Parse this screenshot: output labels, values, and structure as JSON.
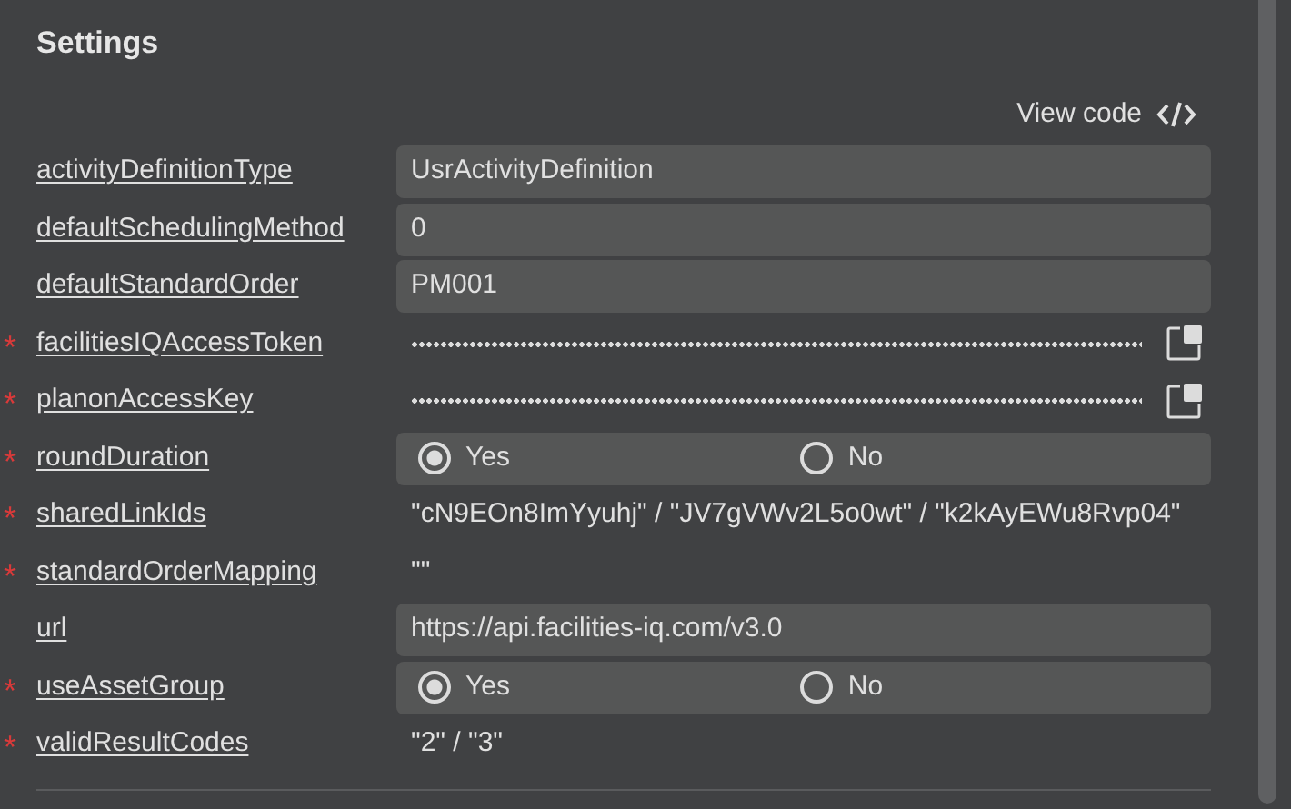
{
  "title": "Settings",
  "view_code": {
    "label": "View code"
  },
  "fields": [
    {
      "label": "activityDefinitionType",
      "kind": "text",
      "value": "UsrActivityDefinition"
    },
    {
      "label": "defaultSchedulingMethod",
      "kind": "text",
      "value": "0"
    },
    {
      "label": "defaultStandardOrder",
      "kind": "text",
      "value": "PM001"
    },
    {
      "label": "facilitiesIQAccessToken",
      "required_mark": "*",
      "kind": "secret"
    },
    {
      "label": "planonAccessKey",
      "required_mark": "*",
      "kind": "secret"
    },
    {
      "label": "roundDuration",
      "required_mark": "*",
      "kind": "radio",
      "options": [
        {
          "label": "Yes",
          "selected": true
        },
        {
          "label": "No",
          "selected": false
        }
      ]
    },
    {
      "label": "sharedLinkIds",
      "required_mark": "*",
      "kind": "plain",
      "value": "\"cN9EOn8ImYyuhj\" / \"JV7gVWv2L5o0wt\" / \"k2kAyEWu8Rvp04\""
    },
    {
      "label": "standardOrderMapping",
      "required_mark": "*",
      "kind": "plain",
      "value": "\"\""
    },
    {
      "label": "url",
      "kind": "text",
      "value": "https://api.facilities-iq.com/v3.0"
    },
    {
      "label": "useAssetGroup",
      "required_mark": "*",
      "kind": "radio",
      "options": [
        {
          "label": "Yes",
          "selected": true
        },
        {
          "label": "No",
          "selected": false
        }
      ]
    },
    {
      "label": "validResultCodes",
      "required_mark": "*",
      "kind": "plain",
      "value": "\"2\" / \"3\""
    }
  ]
}
